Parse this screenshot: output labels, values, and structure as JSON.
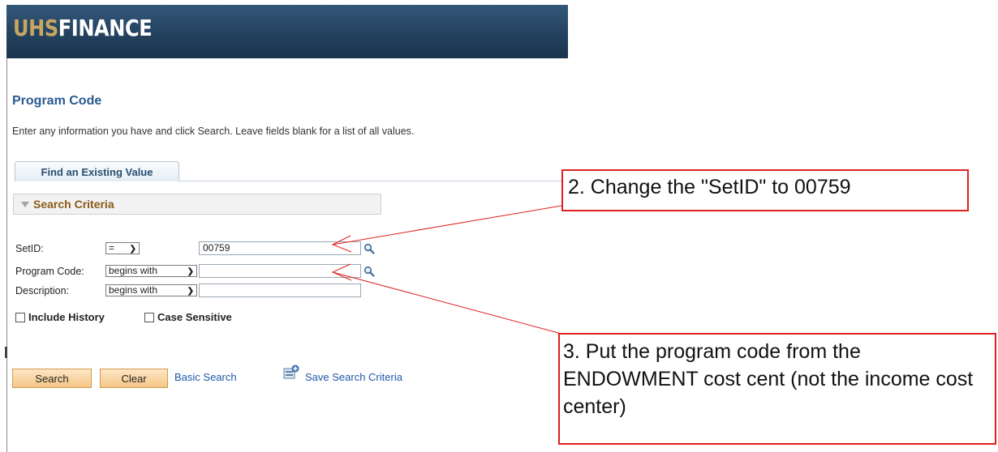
{
  "header": {
    "logo_uhs": "UHS",
    "logo_finance": "FINANCE"
  },
  "page": {
    "title": "Program Code",
    "instructions": "Enter any information you have and click Search. Leave fields blank for a list of all values.",
    "tab_label": "Find an Existing Value",
    "section_title": "Search Criteria"
  },
  "fields": {
    "setid": {
      "label": "SetID:",
      "operator": "=",
      "value": "00759"
    },
    "program_code": {
      "label": "Program Code:",
      "operator": "begins with",
      "value": ""
    },
    "description": {
      "label": "Description:",
      "operator": "begins with",
      "value": ""
    }
  },
  "checkboxes": {
    "include_history": "Include History",
    "case_sensitive": "Case Sensitive"
  },
  "buttons": {
    "search": "Search",
    "clear": "Clear"
  },
  "links": {
    "basic_search": "Basic Search",
    "save_search": "Save Search Criteria"
  },
  "callouts": {
    "step2": "2. Change the \"SetID\" to 00759",
    "step3": "3. Put the program code from the ENDOWMENT cost cent (not the income cost center)"
  },
  "colors": {
    "banner": "#23415f",
    "logo_accent": "#c8a660",
    "title": "#2a5b8f",
    "callout_border": "#e02020",
    "button": "#f6c686"
  }
}
